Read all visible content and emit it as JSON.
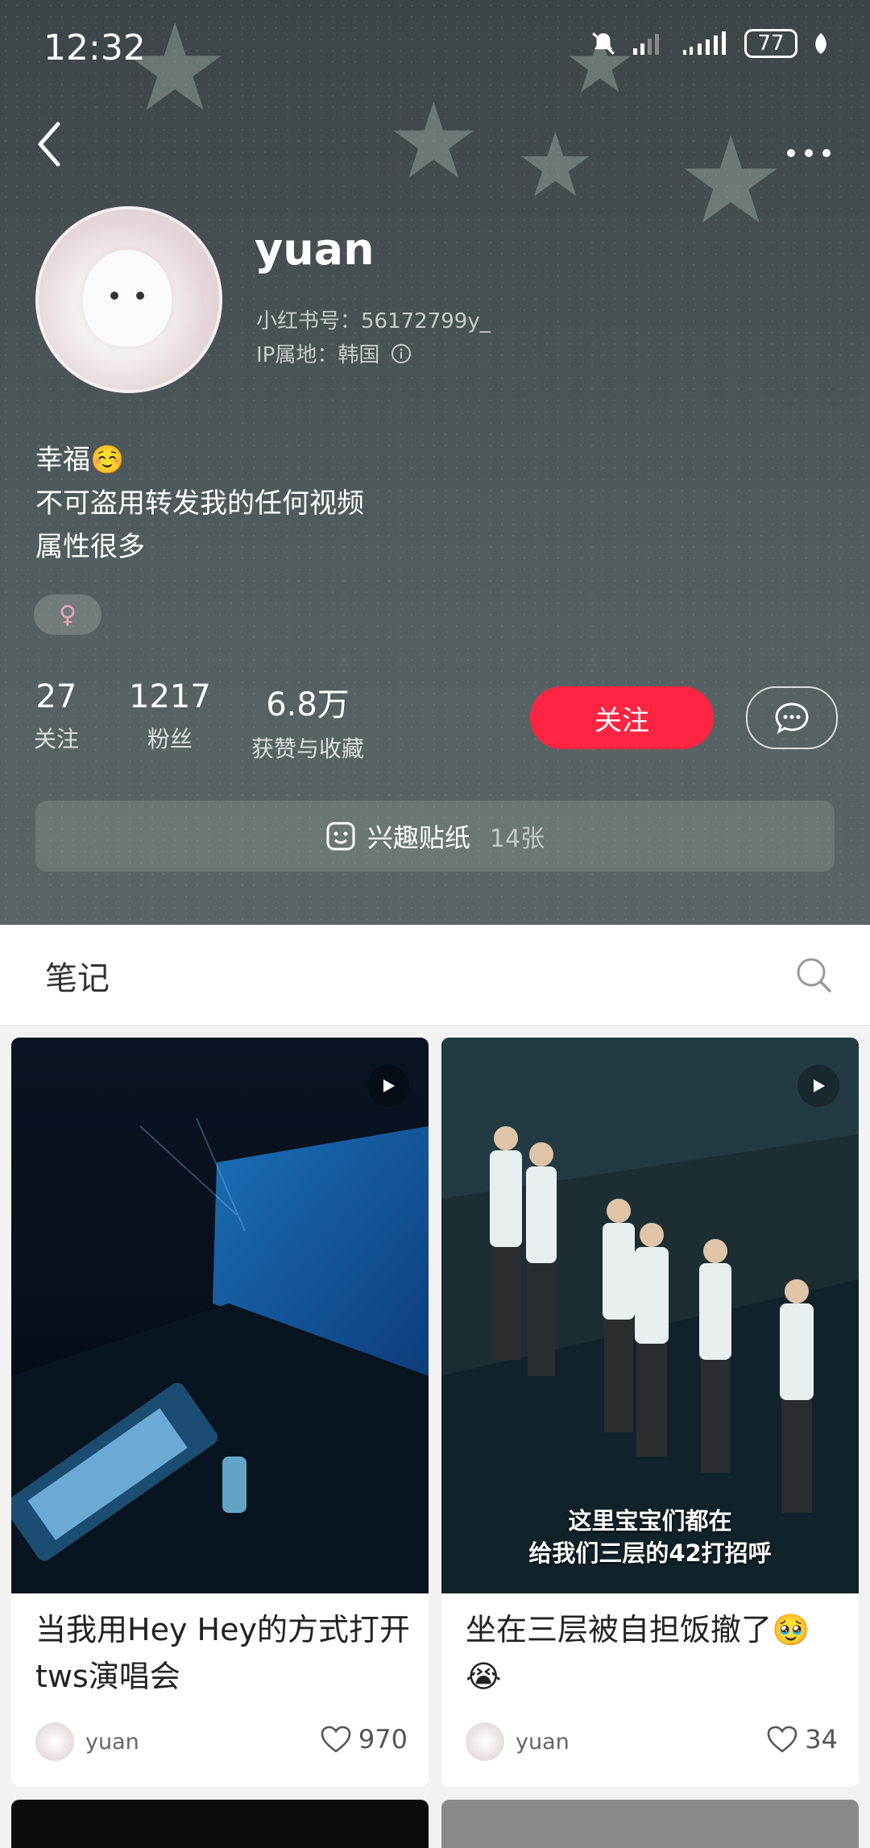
{
  "status_bar": {
    "time": "12:32",
    "battery": "77"
  },
  "profile": {
    "username": "yuan",
    "id_line": "小红书号：56172799y_",
    "ip_line": "IP属地：韩国",
    "bio": [
      "幸福☺️",
      "不可盗用转发我的任何视频",
      "属性很多"
    ],
    "gender_symbol": "♀"
  },
  "stats": [
    {
      "value": "27",
      "label": "关注"
    },
    {
      "value": "1217",
      "label": "粉丝"
    },
    {
      "value": "6.8万",
      "label": "获赞与收藏"
    }
  ],
  "actions": {
    "follow_label": "关注"
  },
  "stickers": {
    "label": "兴趣贴纸",
    "count": "14张"
  },
  "tabs": {
    "notes_label": "笔记"
  },
  "notes": [
    {
      "title": "当我用Hey Hey的方式打开tws演唱会",
      "author": "yuan",
      "likes": "970",
      "overlay": ""
    },
    {
      "title": "坐在三层被自担饭撤了🥹😭",
      "author": "yuan",
      "likes": "34",
      "overlay_line1": "这里宝宝们都在",
      "overlay_line2": "给我们三层的42打招呼"
    }
  ],
  "colors": {
    "accent": "#ff2442"
  }
}
